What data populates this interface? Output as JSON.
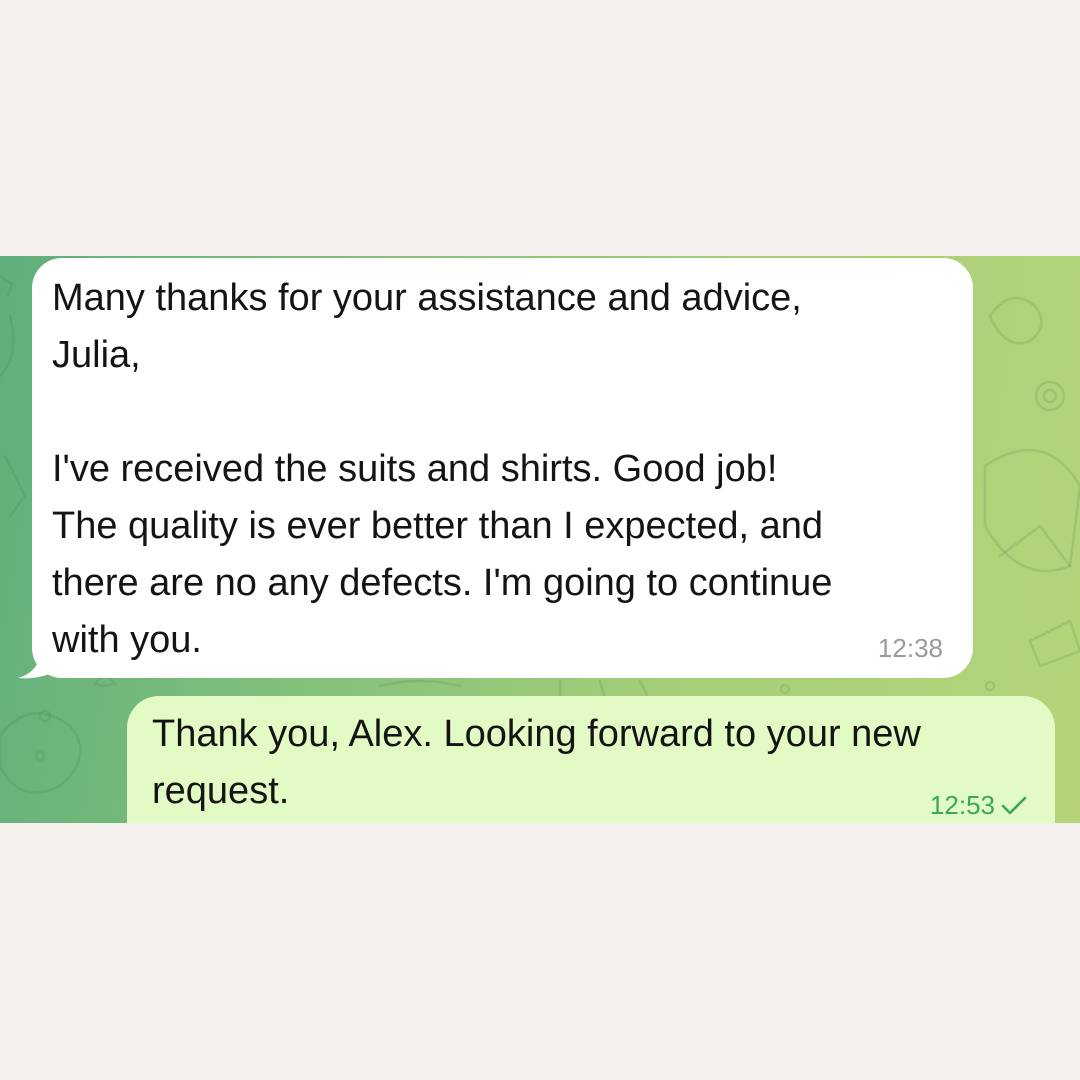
{
  "chat": {
    "incoming": {
      "text": "Many thanks for your assistance and advice,\nJulia,\n\nI've received the suits and shirts. Good job!\nThe quality is ever better than I expected, and\nthere are no any defects. I'm going to continue\nwith you.",
      "time": "12:38"
    },
    "outgoing": {
      "text": "Thank you, Alex. Looking forward to your new\nrequest.",
      "time": "12:53",
      "status_icon": "single-check-icon"
    }
  },
  "colors": {
    "page_background": "#f3f0eb",
    "incoming_bubble": "#ffffff",
    "outgoing_bubble": "#e2fbc4",
    "outgoing_time": "#3aa856",
    "incoming_time": "#9a9a9a"
  }
}
